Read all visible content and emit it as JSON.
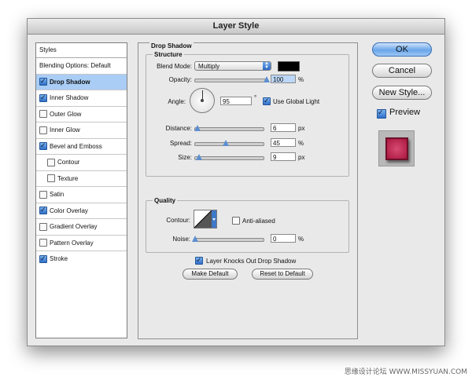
{
  "window": {
    "title": "Layer Style"
  },
  "styles_list": {
    "header": "Styles",
    "items": [
      {
        "label": "Blending Options: Default",
        "has_checkbox": false,
        "checked": false
      },
      {
        "label": "Drop Shadow",
        "has_checkbox": true,
        "checked": true,
        "selected": true
      },
      {
        "label": "Inner Shadow",
        "has_checkbox": true,
        "checked": true
      },
      {
        "label": "Outer Glow",
        "has_checkbox": true,
        "checked": false
      },
      {
        "label": "Inner Glow",
        "has_checkbox": true,
        "checked": false
      },
      {
        "label": "Bevel and Emboss",
        "has_checkbox": true,
        "checked": true
      },
      {
        "label": "Contour",
        "has_checkbox": true,
        "checked": false,
        "sub": true
      },
      {
        "label": "Texture",
        "has_checkbox": true,
        "checked": false,
        "sub": true
      },
      {
        "label": "Satin",
        "has_checkbox": true,
        "checked": false
      },
      {
        "label": "Color Overlay",
        "has_checkbox": true,
        "checked": true
      },
      {
        "label": "Gradient Overlay",
        "has_checkbox": true,
        "checked": false
      },
      {
        "label": "Pattern Overlay",
        "has_checkbox": true,
        "checked": false
      },
      {
        "label": "Stroke",
        "has_checkbox": true,
        "checked": true
      }
    ]
  },
  "drop_shadow": {
    "group_title": "Drop Shadow",
    "structure": {
      "title": "Structure",
      "blend_mode_label": "Blend Mode:",
      "blend_mode_value": "Multiply",
      "shadow_color": "#000000",
      "opacity_label": "Opacity:",
      "opacity_value": "100",
      "opacity_unit": "%",
      "angle_label": "Angle:",
      "angle_value": "95",
      "angle_unit": "°",
      "use_global_light_label": "Use Global Light",
      "use_global_light_checked": true,
      "distance_label": "Distance:",
      "distance_value": "6",
      "distance_unit": "px",
      "spread_label": "Spread:",
      "spread_value": "45",
      "spread_unit": "%",
      "size_label": "Size:",
      "size_value": "9",
      "size_unit": "px"
    },
    "quality": {
      "title": "Quality",
      "contour_label": "Contour:",
      "anti_aliased_label": "Anti-aliased",
      "anti_aliased_checked": false,
      "noise_label": "Noise:",
      "noise_value": "0",
      "noise_unit": "%"
    },
    "knockout_label": "Layer Knocks Out Drop Shadow",
    "knockout_checked": true,
    "make_default_label": "Make Default",
    "reset_default_label": "Reset to Default"
  },
  "buttons": {
    "ok": "OK",
    "cancel": "Cancel",
    "new_style": "New Style...",
    "preview_label": "Preview",
    "preview_checked": true
  },
  "watermark": "思缘设计论坛 WWW.MISSYUAN.COM"
}
